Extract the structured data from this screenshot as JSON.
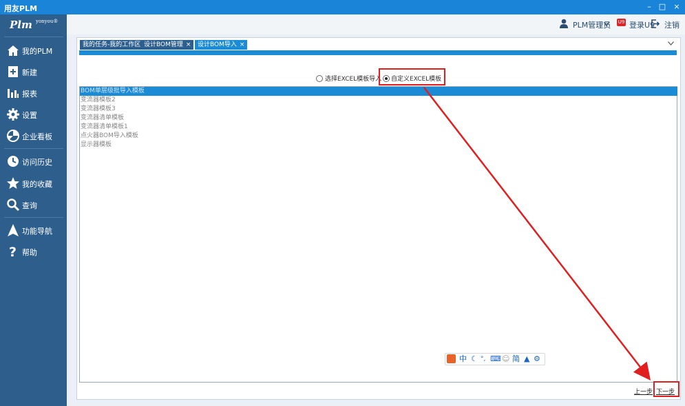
{
  "window": {
    "title": "用友PLM",
    "controls": [
      "–",
      "□",
      "×"
    ]
  },
  "sidebar": {
    "logo_text": "Plm",
    "logo_sup": "yonyou®",
    "items": [
      {
        "label": "我的PLM",
        "icon": "home-icon"
      },
      {
        "label": "新建",
        "icon": "new-doc-icon"
      },
      {
        "label": "报表",
        "icon": "bar-chart-icon"
      },
      {
        "label": "设置",
        "icon": "gear-icon"
      },
      {
        "label": "企业看板",
        "icon": "pie-chart-icon"
      },
      {
        "label": "访问历史",
        "icon": "clock-icon"
      },
      {
        "label": "我的收藏",
        "icon": "star-icon"
      },
      {
        "label": "查询",
        "icon": "search-icon"
      },
      {
        "label": "功能导航",
        "icon": "navigation-icon"
      },
      {
        "label": "帮助",
        "icon": "help-icon"
      }
    ]
  },
  "topbar": {
    "user": "PLM管理员",
    "login_u9": "登录U9",
    "u9_badge": "U9",
    "logout": "注销"
  },
  "tabs": [
    {
      "label": "我的任务-我的工作区",
      "closable": false,
      "active": false
    },
    {
      "label": "设计BOM管理",
      "closable": true,
      "active": false
    },
    {
      "label": "设计BOM导入",
      "closable": true,
      "active": true
    }
  ],
  "tab_close_glyph": "×",
  "import_mode": {
    "option_excel": "选择EXCEL模板导入",
    "option_custom": "自定义EXCEL模板",
    "selected": "custom"
  },
  "templates": [
    "BOM单层级批导入模板",
    "变流器模板2",
    "变流器模板3",
    "变流器清单模板",
    "变流器清单模板1",
    "点火器BOM导入模板",
    "显示器模板"
  ],
  "selected_template_index": 0,
  "ime_toolbar": {
    "items": [
      "中",
      "☾",
      "°,",
      "⌨",
      "☺",
      "简",
      "▲",
      "⚙"
    ]
  },
  "footer": {
    "prev": "上一步",
    "next": "下一步"
  },
  "colors": {
    "accent": "#1b8bd6",
    "sidebar": "#2e5e8c",
    "annotation": "#e02020"
  }
}
